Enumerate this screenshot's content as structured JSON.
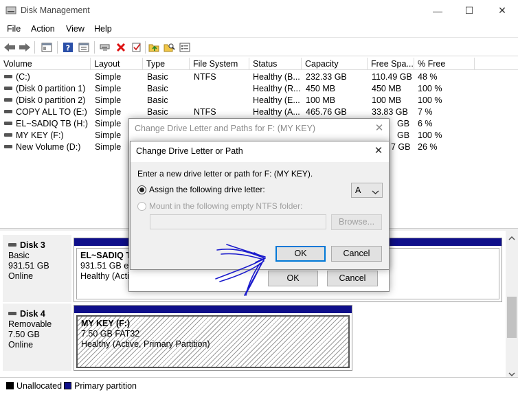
{
  "window": {
    "title": "Disk Management",
    "minimize": "—",
    "maximize": "☐",
    "close": "✕"
  },
  "menu": [
    "File",
    "Action",
    "View",
    "Help"
  ],
  "volume_columns": [
    "Volume",
    "Layout",
    "Type",
    "File System",
    "Status",
    "Capacity",
    "Free Spa...",
    "% Free"
  ],
  "volumes": [
    {
      "name": "(C:)",
      "layout": "Simple",
      "type": "Basic",
      "fs": "NTFS",
      "status": "Healthy (B...",
      "capacity": "232.33 GB",
      "free": "110.49 GB",
      "pct": "48 %"
    },
    {
      "name": "(Disk 0 partition 1)",
      "layout": "Simple",
      "type": "Basic",
      "fs": "",
      "status": "Healthy (R...",
      "capacity": "450 MB",
      "free": "450 MB",
      "pct": "100 %"
    },
    {
      "name": "(Disk 0 partition 2)",
      "layout": "Simple",
      "type": "Basic",
      "fs": "",
      "status": "Healthy (E...",
      "capacity": "100 MB",
      "free": "100 MB",
      "pct": "100 %"
    },
    {
      "name": "COPY ALL TO (E:)",
      "layout": "Simple",
      "type": "Basic",
      "fs": "NTFS",
      "status": "Healthy (A...",
      "capacity": "465.76 GB",
      "free": "33.83 GB",
      "pct": "7 %"
    },
    {
      "name": "EL~SADIQ TB (H:)",
      "layout": "Simple",
      "type": "",
      "fs": "",
      "status": "",
      "capacity": "",
      "free": "GB",
      "pct": "6 %"
    },
    {
      "name": "MY KEY (F:)",
      "layout": "Simple",
      "type": "",
      "fs": "",
      "status": "",
      "capacity": "",
      "free": "GB",
      "pct": "100 %"
    },
    {
      "name": "New Volume (D:)",
      "layout": "Simple",
      "type": "",
      "fs": "",
      "status": "",
      "capacity": "",
      "free": "7 GB",
      "pct": "26 %"
    }
  ],
  "disks": [
    {
      "name": "Disk 3",
      "kind": "Basic",
      "size": "931.51 GB",
      "state": "Online",
      "partition": {
        "label": "EL~SADIQ TB",
        "detail": "931.51 GB exF",
        "status": "Healthy (Activ"
      }
    },
    {
      "name": "Disk 4",
      "kind": "Removable",
      "size": "7.50 GB",
      "state": "Online",
      "partition": {
        "label": "MY KEY  (F:)",
        "detail": "7.50 GB FAT32",
        "status": "Healthy (Active, Primary Partition)"
      }
    }
  ],
  "legend": [
    {
      "label": "Unallocated",
      "color": "#000000"
    },
    {
      "label": "Primary partition",
      "color": "#0f0f8a"
    }
  ],
  "outer_dialog": {
    "title": "Change Drive Letter and Paths for F: (MY KEY)",
    "ok": "OK",
    "cancel": "Cancel"
  },
  "inner_dialog": {
    "title": "Change Drive Letter or Path",
    "prompt": "Enter a new drive letter or path for F: (MY KEY).",
    "assign_label": "Assign the following drive letter:",
    "drive_letter": "A",
    "mount_label": "Mount in the following empty NTFS folder:",
    "folder_path": "",
    "browse": "Browse...",
    "ok": "OK",
    "cancel": "Cancel"
  },
  "colors": {
    "accent": "#0078d7",
    "primary_partition": "#0f0f8a",
    "annotation": "#1a1acc"
  }
}
